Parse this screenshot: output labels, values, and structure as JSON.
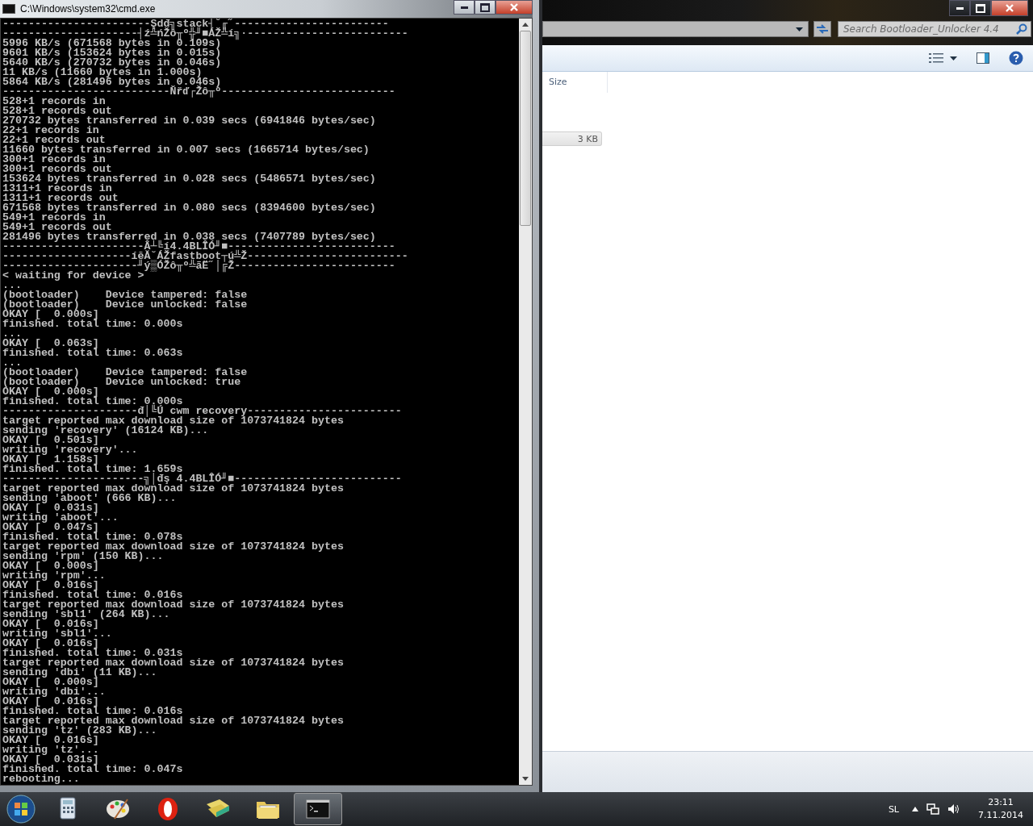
{
  "console_window": {
    "title": "C:\\Windows\\system32\\cmd.exe",
    "lines": [
      "-----------------------Şdđ╗stack┤˘╓˝------------------------",
      "---------------------┤ź╩ńŽô╥º╬╜■ÁŽ╩í╗·-------------------------",
      "5996 KB/s (671568 bytes in 0.109s)",
      "9601 KB/s (153624 bytes in 0.015s)",
      "5640 KB/s (270732 bytes in 0.046s)",
      "11 KB/s (11660 bytes in 1.000s)",
      "5864 KB/s (281496 bytes in 0.046s)",
      "--------------------------Ňřď┌Žô╥º---------------------------",
      "528+1 records in",
      "528+1 records out",
      "270732 bytes transferred in 0.039 secs (6941846 bytes/sec)",
      "22+1 records in",
      "22+1 records out",
      "11660 bytes transferred in 0.007 secs (1665714 bytes/sec)",
      "300+1 records in",
      "300+1 records out",
      "153624 bytes transferred in 0.028 secs (5486571 bytes/sec)",
      "1311+1 records in",
      "1311+1 records out",
      "671568 bytes transferred in 0.080 secs (8394600 bytes/sec)",
      "549+1 records in",
      "549+1 records out",
      "281496 bytes transferred in 0.038 secs (7407789 bytes/sec)",
      "----------------------Â┴╚í4.4BLÎÓ╜■--------------------------",
      "--------------------íĕĂ˘ÁŽfastboot┬ú╩Ž-------------------------",
      "---------------------╜ý▒ÓŽô╥º╩ãË˝│╔Ž-------------------------",
      "< waiting for device >",
      "...",
      "(bootloader)    Device tampered: false",
      "(bootloader)    Device unlocked: false",
      "OKAY [  0.000s]",
      "finished. total time: 0.000s",
      "...",
      "OKAY [  0.063s]",
      "finished. total time: 0.063s",
      "...",
      "(bootloader)    Device tampered: false",
      "(bootloader)    Device unlocked: true",
      "OKAY [  0.000s]",
      "finished. total time: 0.000s",
      "---------------------đ│╚Ú cwm recovery------------------------",
      "target reported max download size of 1073741824 bytes",
      "sending 'recovery' (16124 KB)...",
      "OKAY [  0.501s]",
      "writing 'recovery'...",
      "OKAY [  1.158s]",
      "finished. total time: 1.659s",
      "----------------------╗│đş 4.4BLÎÓ╜■--------------------------",
      "target reported max download size of 1073741824 bytes",
      "sending 'aboot' (666 KB)...",
      "OKAY [  0.031s]",
      "writing 'aboot'...",
      "OKAY [  0.047s]",
      "finished. total time: 0.078s",
      "target reported max download size of 1073741824 bytes",
      "sending 'rpm' (150 KB)...",
      "OKAY [  0.000s]",
      "writing 'rpm'...",
      "OKAY [  0.016s]",
      "finished. total time: 0.016s",
      "target reported max download size of 1073741824 bytes",
      "sending 'sbl1' (264 KB)...",
      "OKAY [  0.016s]",
      "writing 'sbl1'...",
      "OKAY [  0.016s]",
      "finished. total time: 0.031s",
      "target reported max download size of 1073741824 bytes",
      "sending 'dbi' (11 KB)...",
      "OKAY [  0.000s]",
      "writing 'dbi'...",
      "OKAY [  0.016s]",
      "finished. total time: 0.016s",
      "target reported max download size of 1073741824 bytes",
      "sending 'tz' (283 KB)...",
      "OKAY [  0.016s]",
      "writing 'tz'...",
      "OKAY [  0.031s]",
      "finished. total time: 0.047s",
      "rebooting..."
    ]
  },
  "explorer_window": {
    "search": {
      "placeholder": "Search Bootloader_Unlocker 4.4"
    },
    "columns": [
      {
        "label": "Size"
      }
    ],
    "rows": [
      {
        "size": "3 KB",
        "selected": true
      }
    ]
  },
  "taskbar": {
    "items": [
      {
        "kind": "calculator",
        "active": false
      },
      {
        "kind": "paint",
        "active": false
      },
      {
        "kind": "opera",
        "active": false
      },
      {
        "kind": "folders",
        "active": false
      },
      {
        "kind": "explorer",
        "active": false
      },
      {
        "kind": "console",
        "active": true
      }
    ],
    "language": "SL",
    "time": "23:11",
    "date": "7.11.2014"
  }
}
